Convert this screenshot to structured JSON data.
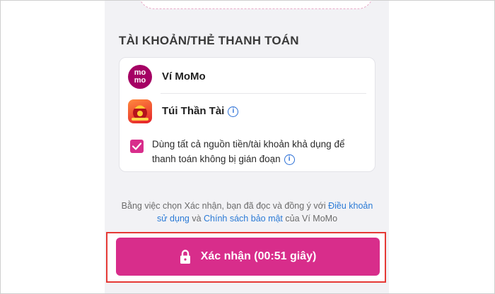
{
  "section": {
    "title": "TÀI KHOẢN/THẺ THANH TOÁN"
  },
  "accounts": [
    {
      "label": "Ví MoMo",
      "logo_text_top": "mo",
      "logo_text_bottom": "mo",
      "icon": "momo-logo"
    },
    {
      "label": "Túi Thần Tài",
      "info": "i",
      "icon": "tui-than-tai-logo"
    }
  ],
  "auto_use": {
    "checked": true,
    "text": "Dùng tất cả nguồn tiền/tài khoản khả dụng để thanh toán không bị gián đoạn",
    "info": "i"
  },
  "terms": {
    "prefix": "Bằng việc chọn Xác nhận, bạn đã đọc và đồng ý với ",
    "link1": "Điều khoản sử dụng",
    "middle": " và ",
    "link2": "Chính sách bảo mật",
    "suffix": " của Ví MoMo"
  },
  "confirm": {
    "label": "Xác nhận (00:51 giây)",
    "icon": "lock-icon"
  },
  "colors": {
    "brand": "#a50064",
    "accent": "#d82d8b",
    "link": "#2a7ad6",
    "highlight": "#e53935"
  }
}
